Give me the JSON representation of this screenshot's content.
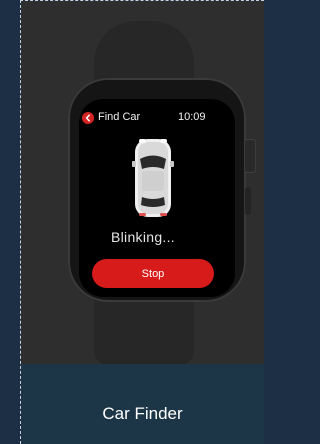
{
  "watch": {
    "header": {
      "back_icon": "chevron-left-icon",
      "title": "Find Car",
      "time": "10:09"
    },
    "car_icon": "car-top-view-icon",
    "status": "Blinking...",
    "stop_label": "Stop"
  },
  "caption": "Car Finder",
  "colors": {
    "accent": "#d71a1a",
    "page_background": "#1c2f45",
    "caption_background": "#1d3647"
  }
}
